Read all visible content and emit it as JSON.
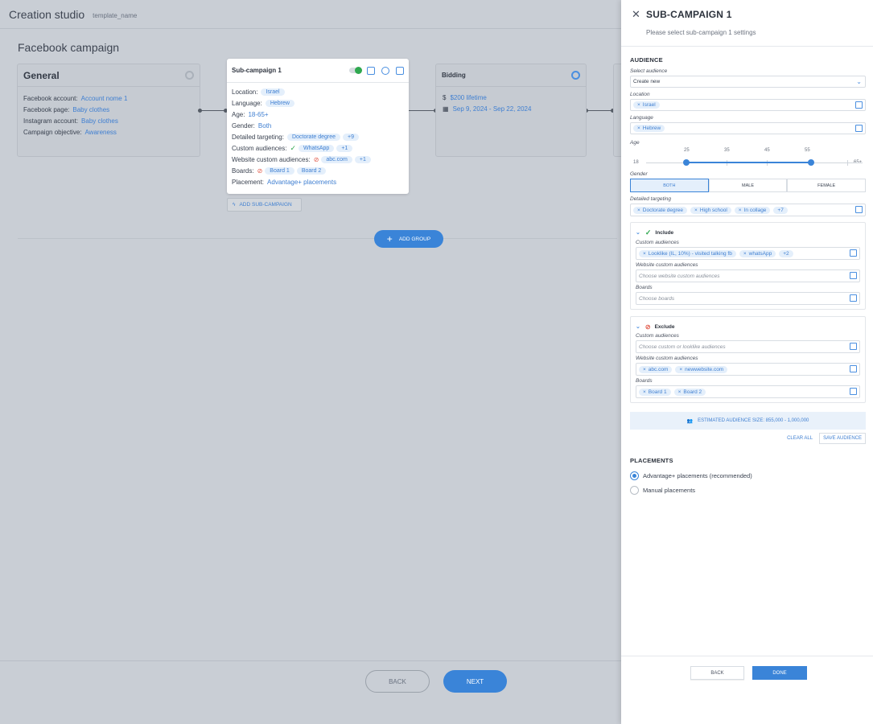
{
  "header": {
    "title": "Creation studio",
    "subtitle": "template_name"
  },
  "campaign_title": "Facebook campaign",
  "general": {
    "title": "General",
    "rows": [
      {
        "label": "Facebook account:",
        "value": "Account nome 1"
      },
      {
        "label": "Facebook page:",
        "value": "Baby clothes"
      },
      {
        "label": "Instagram account:",
        "value": "Baby clothes"
      },
      {
        "label": "Campaign objective:",
        "value": "Awareness"
      }
    ]
  },
  "sub_card": {
    "title": "Sub-campaign 1",
    "location_label": "Location:",
    "location": "Israel",
    "language_label": "Language:",
    "language": "Hebrew",
    "age_label": "Age:",
    "age": "18-65+",
    "gender_label": "Gender:",
    "gender": "Both",
    "detailed_label": "Detailed targeting:",
    "detailed": "Doctorate degree",
    "detailed_more": "+9",
    "custom_label": "Custom audiences:",
    "custom": "WhatsApp",
    "custom_more": "+1",
    "website_label": "Website custom audiences:",
    "website": "abc.com",
    "website_more": "+1",
    "boards_label": "Boards:",
    "board1": "Board 1",
    "board2": "Board 2",
    "placement_label": "Placement:",
    "placement": "Advantage+ placements"
  },
  "bidding": {
    "title": "Bidding",
    "budget": "$200 lifetime",
    "dates": "Sep 9, 2024 - Sep 22, 2024"
  },
  "add_sub_label": "ADD SUB-CAMPAIGN",
  "add_group_label": "ADD GROUP",
  "footer": {
    "back": "BACK",
    "next": "NEXT"
  },
  "drawer": {
    "title": "SUB-CAMPAIGN 1",
    "subtitle": "Please select sub-campaign 1 settings",
    "audience_title": "AUDIENCE",
    "select_audience_label": "Select audience",
    "select_audience_value": "Create new",
    "location_label": "Location",
    "location_chip": "Israel",
    "language_label": "Language",
    "language_chip": "Hebrew",
    "age_label": "Age",
    "age_ticks": [
      "18",
      "25",
      "35",
      "45",
      "55",
      "65+"
    ],
    "age_range": {
      "min": 25,
      "max": 55
    },
    "gender_label": "Gender",
    "gender_options": [
      "BOTH",
      "MALE",
      "FEMALE"
    ],
    "gender_selected": "BOTH",
    "detailed_label": "Detailed targeting",
    "detailed_chips": [
      "Doctorate degree",
      "High school",
      "In collage"
    ],
    "detailed_more": "+7",
    "include": {
      "title": "Include",
      "custom_label": "Custom audiences",
      "custom_chips": [
        "Looklike (IL, 10%) - visited talking fb",
        "whatsApp"
      ],
      "custom_more": "+2",
      "website_label": "Website custom audiences",
      "website_placeholder": "Choose website custom audiences",
      "boards_label": "Boards",
      "boards_placeholder": "Choose boards"
    },
    "exclude": {
      "title": "Exclude",
      "custom_label": "Custom audiences",
      "custom_placeholder": "Choose custom or looklike audiences",
      "website_label": "Website custom audiences",
      "website_chips": [
        "abc.com",
        "newwebsite.com"
      ],
      "boards_label": "Boards",
      "boards_chips": [
        "Board 1",
        "Board 2"
      ]
    },
    "estimated": "ESTIMATED AUDIENCE SIZE: 855,000 - 1,000,000",
    "clear_all": "CLEAR ALL",
    "save_audience": "SAVE AUDIENCE",
    "placements_title": "PLACEMENTS",
    "placement_options": [
      "Advantage+ placements (recommended)",
      "Manual placements"
    ],
    "placement_selected": "Advantage+ placements (recommended)",
    "back": "BACK",
    "done": "DONE"
  },
  "colors": {
    "accent": "#3a84d8",
    "status_on": "#2fa84f",
    "exclude_red": "#e25b4b",
    "overlay": "#c9ced5"
  }
}
